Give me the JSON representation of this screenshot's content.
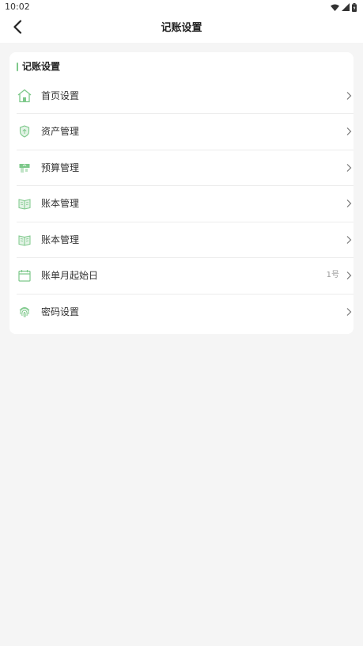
{
  "status_bar": {
    "time": "10:02",
    "icons": [
      "wifi-icon",
      "signal-icon",
      "battery-icon"
    ]
  },
  "nav": {
    "title": "记账设置",
    "back_icon": "back-arrow-icon"
  },
  "card": {
    "section_title": "记账设置",
    "accent_color": "#7dc88a",
    "items": [
      {
        "label": "首页设置",
        "icon": "home-icon",
        "value": ""
      },
      {
        "label": "资产管理",
        "icon": "shield-icon",
        "value": ""
      },
      {
        "label": "预算管理",
        "icon": "wallet-icon",
        "value": ""
      },
      {
        "label": "账本管理",
        "icon": "book-icon",
        "value": ""
      },
      {
        "label": "账本管理",
        "icon": "book-icon",
        "value": ""
      },
      {
        "label": "账单月起始日",
        "icon": "calendar-icon",
        "value": "1号"
      },
      {
        "label": "密码设置",
        "icon": "fingerprint-icon",
        "value": ""
      }
    ]
  }
}
